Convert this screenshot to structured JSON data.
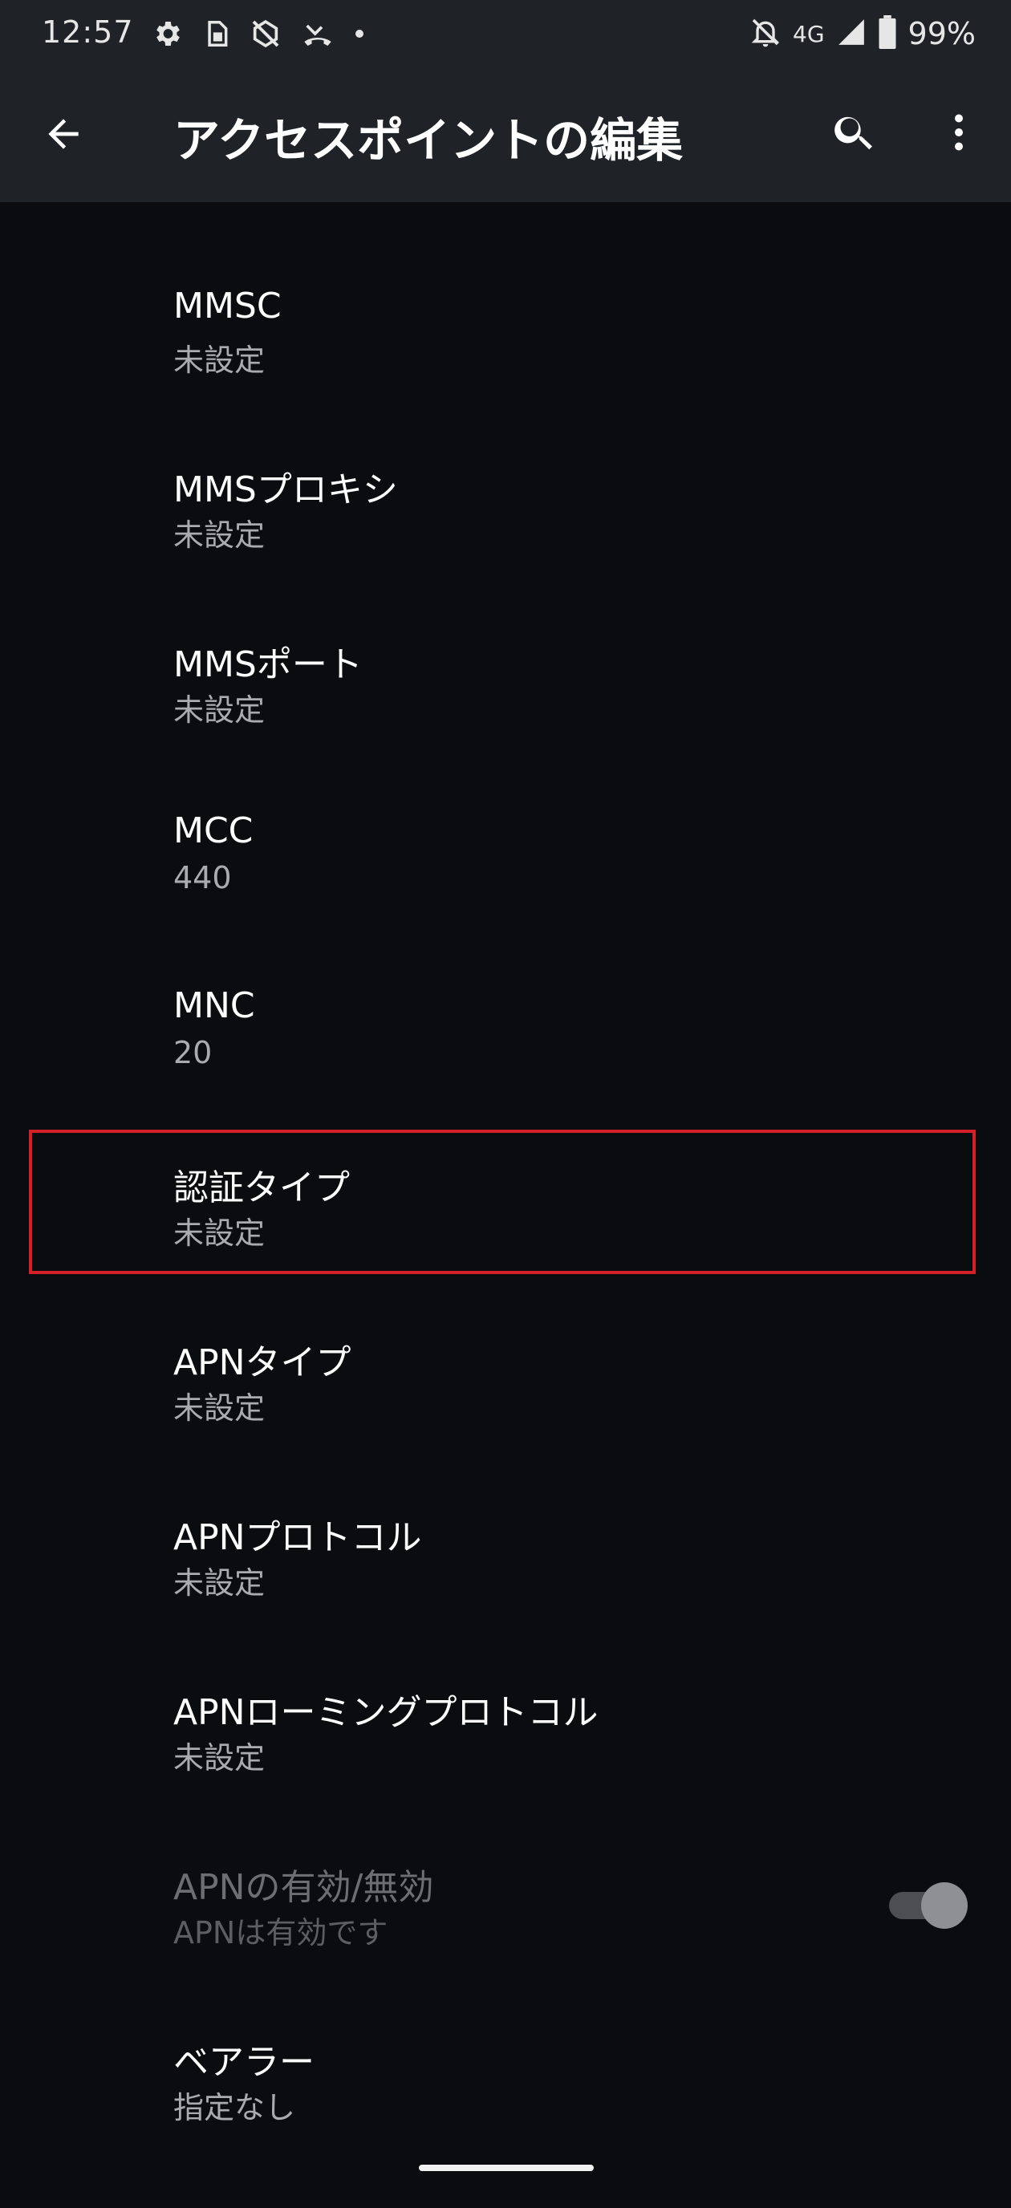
{
  "status_bar": {
    "time": "12:57",
    "network": "4G",
    "battery": "99%",
    "icons_left": [
      "settings-icon",
      "sim-card-icon",
      "sync-disabled-icon",
      "missed-call-icon",
      "dot-icon"
    ],
    "icons_right": [
      "notifications-off-icon",
      "signal-icon",
      "battery-icon"
    ]
  },
  "app_bar": {
    "title": "アクセスポイントの編集",
    "icons": [
      "arrow-back-icon",
      "search-icon",
      "more-vert-icon"
    ]
  },
  "preferences": [
    {
      "title": "MMSC",
      "summary": "未設定"
    },
    {
      "title": "MMSプロキシ",
      "summary": "未設定"
    },
    {
      "title": "MMSポート",
      "summary": "未設定"
    },
    {
      "title": "MCC",
      "summary": "440"
    },
    {
      "title": "MNC",
      "summary": "20"
    },
    {
      "title": "認証タイプ",
      "summary": "未設定",
      "highlighted": true
    },
    {
      "title": "APNタイプ",
      "summary": "未設定"
    },
    {
      "title": "APNプロトコル",
      "summary": "未設定"
    },
    {
      "title": "APNローミングプロトコル",
      "summary": "未設定"
    },
    {
      "title": "APNの有効/無効",
      "summary": "APNは有効です",
      "disabled": true,
      "toggle_on": true
    },
    {
      "title": "ベアラー",
      "summary": "指定なし"
    }
  ],
  "colors": {
    "background": "#0b0c0f",
    "header": "#1f2327",
    "highlight": "#d5202a",
    "summary_text": "#a9abaf"
  }
}
